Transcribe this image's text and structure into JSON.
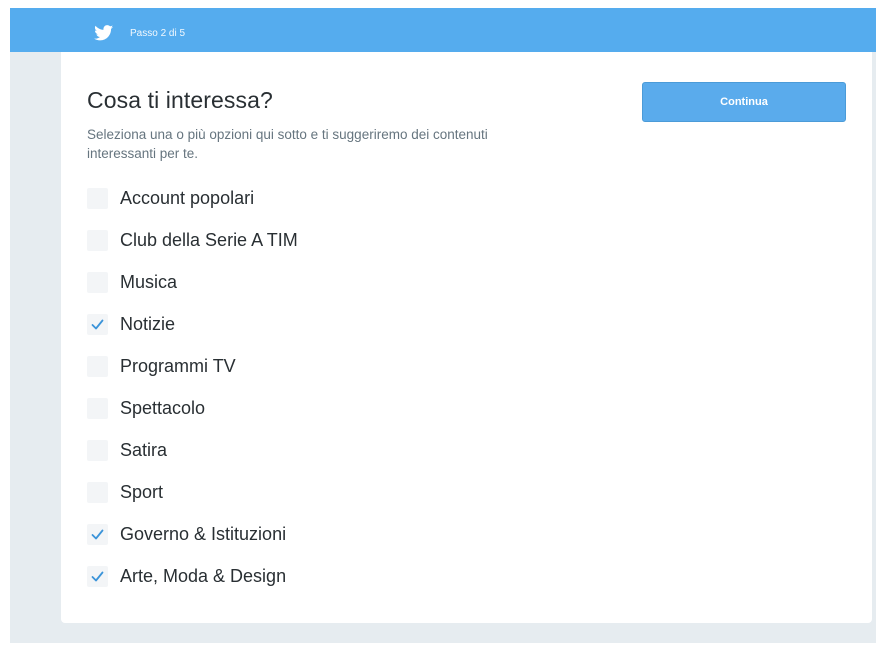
{
  "header": {
    "brand_icon": "twitter-bird-icon",
    "step_text": "Passo 2 di 5"
  },
  "main": {
    "title": "Cosa ti interessa?",
    "subtitle": "Seleziona una o più opzioni qui sotto e ti suggeriremo dei contenuti interessanti per te.",
    "continue_label": "Continua"
  },
  "options": [
    {
      "label": "Account popolari",
      "checked": false
    },
    {
      "label": "Club della Serie A TIM",
      "checked": false
    },
    {
      "label": "Musica",
      "checked": false
    },
    {
      "label": "Notizie",
      "checked": true
    },
    {
      "label": "Programmi TV",
      "checked": false
    },
    {
      "label": "Spettacolo",
      "checked": false
    },
    {
      "label": "Satira",
      "checked": false
    },
    {
      "label": "Sport",
      "checked": false
    },
    {
      "label": "Governo & Istituzioni",
      "checked": true
    },
    {
      "label": "Arte, Moda & Design",
      "checked": true
    }
  ],
  "colors": {
    "brand_blue": "#55acee",
    "page_bg": "#e6ecf0",
    "checkmark": "#3b94d9",
    "text": "#292f33",
    "muted_text": "#66757f"
  }
}
